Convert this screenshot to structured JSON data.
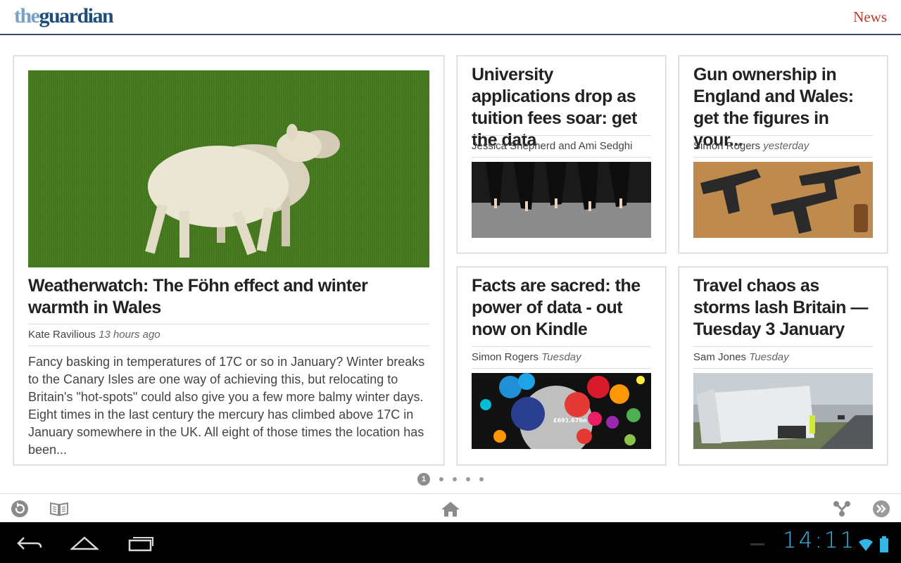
{
  "header": {
    "logo_the": "the",
    "logo_guardian": "guardian",
    "section": "News"
  },
  "main_article": {
    "headline": "Weatherwatch: The Föhn effect and winter warmth in Wales",
    "author": "Kate Ravilious",
    "time": "13 hours ago",
    "summary": "Fancy basking in temperatures of 17C or so in January? Winter breaks to the Canary Isles are one way of achieving this, but relocating to Britain's \"hot-spots\" could also give you a few more balmy winter days. Eight times in the last century the mercury has climbed above 17C in January somewhere in the UK. All eight of those times the location has been..."
  },
  "articles": [
    {
      "headline": "University applications drop as tuition fees soar: get the data",
      "author": "Jessica Shepherd and Ami Sedghi",
      "time": ""
    },
    {
      "headline": "Gun ownership in England and Wales: get the figures in your...",
      "author": "Simon Rogers",
      "time": "yesterday"
    },
    {
      "headline": "Facts are sacred: the power of data - out now on Kindle",
      "author": "Simon Rogers",
      "time": "Tuesday"
    },
    {
      "headline": "Travel chaos as storms lash Britain — Tuesday 3 January",
      "author": "Sam Jones",
      "time": "Tuesday"
    }
  ],
  "kindle_image_text": "£691.67bn",
  "pager": {
    "current": "1",
    "total_dots": 5
  },
  "toolbar": {
    "icons": [
      "refresh-icon",
      "reading-list-icon",
      "home-icon",
      "share-icon",
      "next-icon"
    ]
  },
  "statusbar": {
    "clock": "14:11"
  },
  "colors": {
    "brand_dark": "#1d4e7a",
    "brand_light": "#7aa2c8",
    "section": "#c0392b",
    "clock": "#33b5e5"
  }
}
